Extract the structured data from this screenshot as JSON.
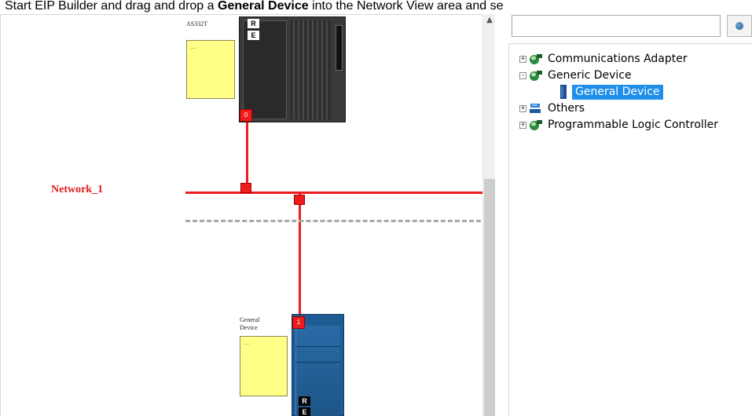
{
  "instruction": {
    "prefix": "Start EIP Builder and drag and drop a ",
    "bold": "General Device",
    "suffix": " into the Network View area and se"
  },
  "network_view": {
    "network_label": "Network_1",
    "plc": {
      "name": "AS332T",
      "note": "....",
      "node_number": "0",
      "tags": [
        "R",
        "E"
      ]
    },
    "general_device": {
      "name_line1": "General",
      "name_line2": "Device",
      "note": "....",
      "node_number": "1",
      "tags": [
        "R",
        "E"
      ]
    }
  },
  "device_tree": {
    "search": {
      "placeholder": "",
      "value": ""
    },
    "items": [
      {
        "label": "Communications Adapter",
        "expander": "+",
        "icon": "globe-network-icon"
      },
      {
        "label": "Generic Device",
        "expander": "-",
        "icon": "globe-network-icon"
      },
      {
        "label": "General Device",
        "icon": "device-module-icon",
        "selected": true
      },
      {
        "label": "Others",
        "expander": "+",
        "icon": "others-icon"
      },
      {
        "label": "Programmable Logic Controller",
        "expander": "+",
        "icon": "globe-network-icon"
      }
    ]
  },
  "colors": {
    "network_line": "#ee1c1c",
    "selection": "#1f8fea",
    "note_yellow": "#ffff88",
    "device_blue": "#1f5c93",
    "plc_dark": "#3a3a3a"
  }
}
